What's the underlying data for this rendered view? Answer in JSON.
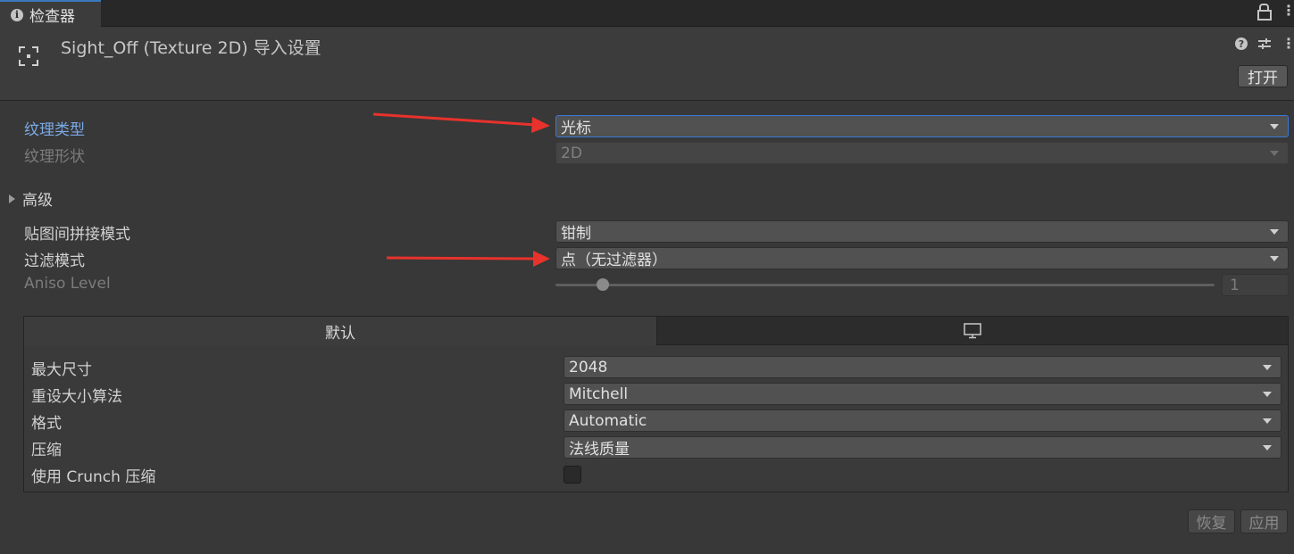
{
  "tab": {
    "label": "检查器",
    "icon": "info-icon"
  },
  "header": {
    "title": "Sight_Off (Texture 2D) 导入设置",
    "open_label": "打开",
    "icons": [
      "help-icon",
      "settings-sliders-icon",
      "more-icon"
    ]
  },
  "fields": {
    "texture_type": {
      "label": "纹理类型",
      "value": "光标"
    },
    "texture_shape": {
      "label": "纹理形状",
      "value": "2D"
    },
    "advanced": {
      "label": "高级"
    },
    "wrap_mode": {
      "label": "贴图间拼接模式",
      "value": "钳制"
    },
    "filter_mode": {
      "label": "过滤模式",
      "value": "点（无过滤器）"
    },
    "aniso_level": {
      "label": "Aniso Level",
      "value": "1"
    }
  },
  "platform": {
    "default_tab": "默认",
    "pc_tab_icon": "monitor-icon",
    "max_size": {
      "label": "最大尺寸",
      "value": "2048"
    },
    "resize_algorithm": {
      "label": "重设大小算法",
      "value": "Mitchell"
    },
    "format": {
      "label": "格式",
      "value": "Automatic"
    },
    "compression": {
      "label": "压缩",
      "value": "法线质量"
    },
    "crunch": {
      "label": "使用 Crunch 压缩",
      "checked": false
    }
  },
  "footer": {
    "revert_label": "恢复",
    "apply_label": "应用"
  },
  "colors": {
    "accent": "#3a79d8",
    "annotation_arrow": "#e8322c",
    "active_label": "#7aa9e6"
  }
}
